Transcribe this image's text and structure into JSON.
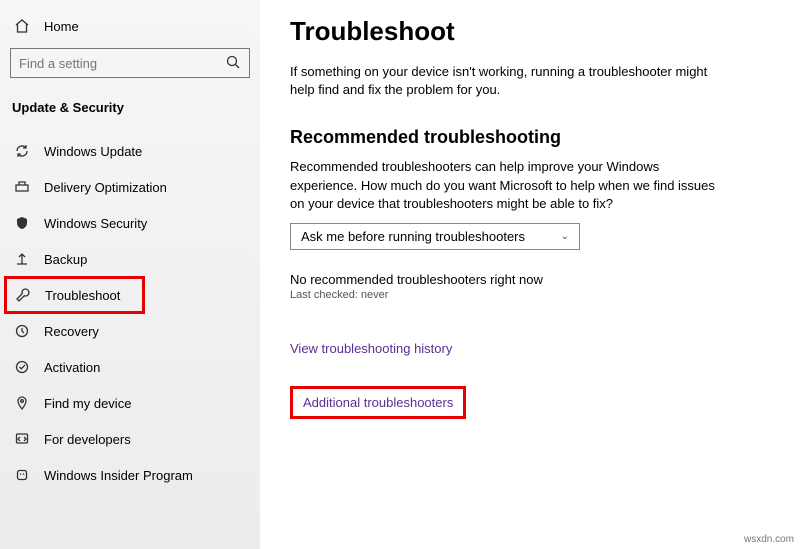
{
  "sidebar": {
    "home": "Home",
    "search_placeholder": "Find a setting",
    "section": "Update & Security",
    "items": [
      {
        "label": "Windows Update"
      },
      {
        "label": "Delivery Optimization"
      },
      {
        "label": "Windows Security"
      },
      {
        "label": "Backup"
      },
      {
        "label": "Troubleshoot"
      },
      {
        "label": "Recovery"
      },
      {
        "label": "Activation"
      },
      {
        "label": "Find my device"
      },
      {
        "label": "For developers"
      },
      {
        "label": "Windows Insider Program"
      }
    ]
  },
  "main": {
    "title": "Troubleshoot",
    "intro": "If something on your device isn't working, running a troubleshooter might help find and fix the problem for you.",
    "rec_heading": "Recommended troubleshooting",
    "rec_body": "Recommended troubleshooters can help improve your Windows experience. How much do you want Microsoft to help when we find issues on your device that troubleshooters might be able to fix?",
    "dropdown_value": "Ask me before running troubleshooters",
    "status": "No recommended troubleshooters right now",
    "last_checked": "Last checked: never",
    "history_link": "View troubleshooting history",
    "additional_link": "Additional troubleshooters"
  },
  "watermark": "wsxdn.com"
}
